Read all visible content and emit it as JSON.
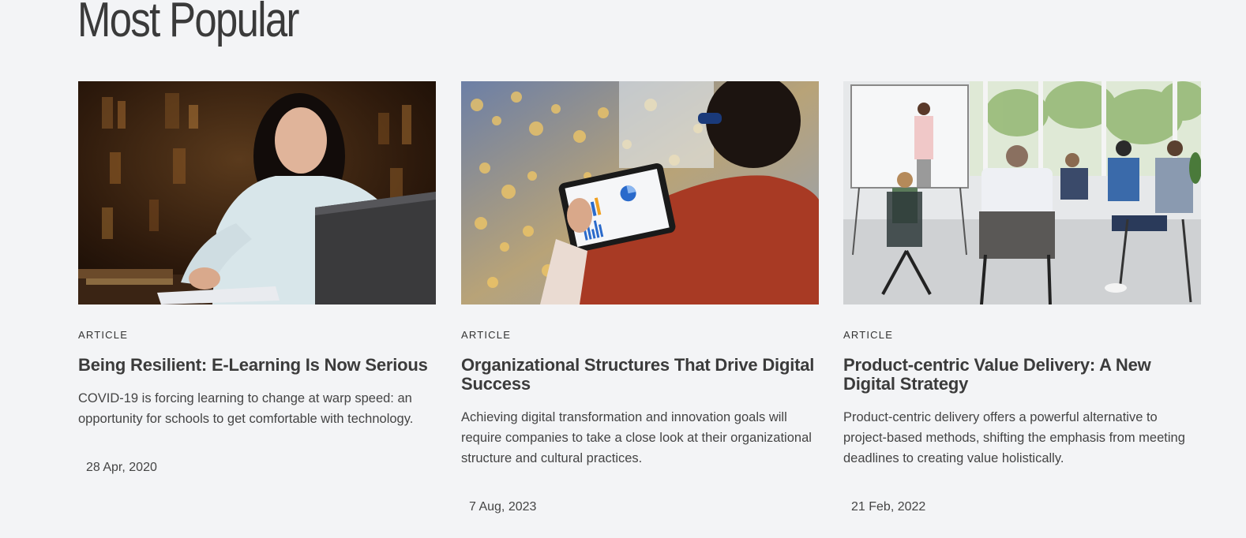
{
  "section": {
    "title": "Most Popular"
  },
  "cards": [
    {
      "type": "ARTICLE",
      "title": "Being Resilient: E-Learning Is Now Serious",
      "description": "COVID-19 is forcing learning to change at warp speed: an opportunity for schools to get comfortable with technology.",
      "date": "28 Apr, 2020",
      "image": "woman-studying-laptop-photo"
    },
    {
      "type": "ARTICLE",
      "title": "Organizational Structures That Drive Digital Success",
      "description": "Achieving digital transformation and innovation goals will require companies to take a close look at their organizational structure and cultural practices.",
      "date": "7 Aug, 2023",
      "image": "tablet-charts-photo"
    },
    {
      "type": "ARTICLE",
      "title": "Product-centric Value Delivery: A New Digital Strategy",
      "description": "Product-centric delivery offers a powerful alternative to project-based methods, shifting the emphasis from meeting deadlines to creating value holistically.",
      "date": "21 Feb, 2022",
      "image": "team-meeting-whiteboard-photo"
    }
  ]
}
